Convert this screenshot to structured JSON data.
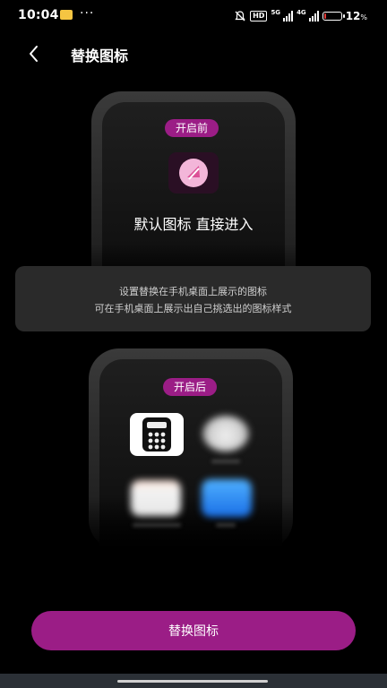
{
  "status_bar": {
    "time": "10:04",
    "more": "···",
    "hd": "HD",
    "net1": "5G",
    "net2": "4G",
    "battery_percent": "12",
    "percent_sign": "%",
    "battery_level": 0.12
  },
  "header": {
    "title": "替换图标"
  },
  "preview_before": {
    "badge": "开启前",
    "label": "默认图标 直接进入"
  },
  "info_card": {
    "line1": "设置替换在手机桌面上展示的图标",
    "line2": "可在手机桌面上展示出自己挑选出的图标样式"
  },
  "preview_after": {
    "badge": "开启后",
    "icons": [
      "calculator-icon",
      "clock-icon",
      "notes-icon",
      "mail-icon"
    ]
  },
  "cta": {
    "label": "替换图标"
  },
  "colors": {
    "accent": "#9b1d86",
    "background": "#000000",
    "card": "#2a2a2a"
  }
}
